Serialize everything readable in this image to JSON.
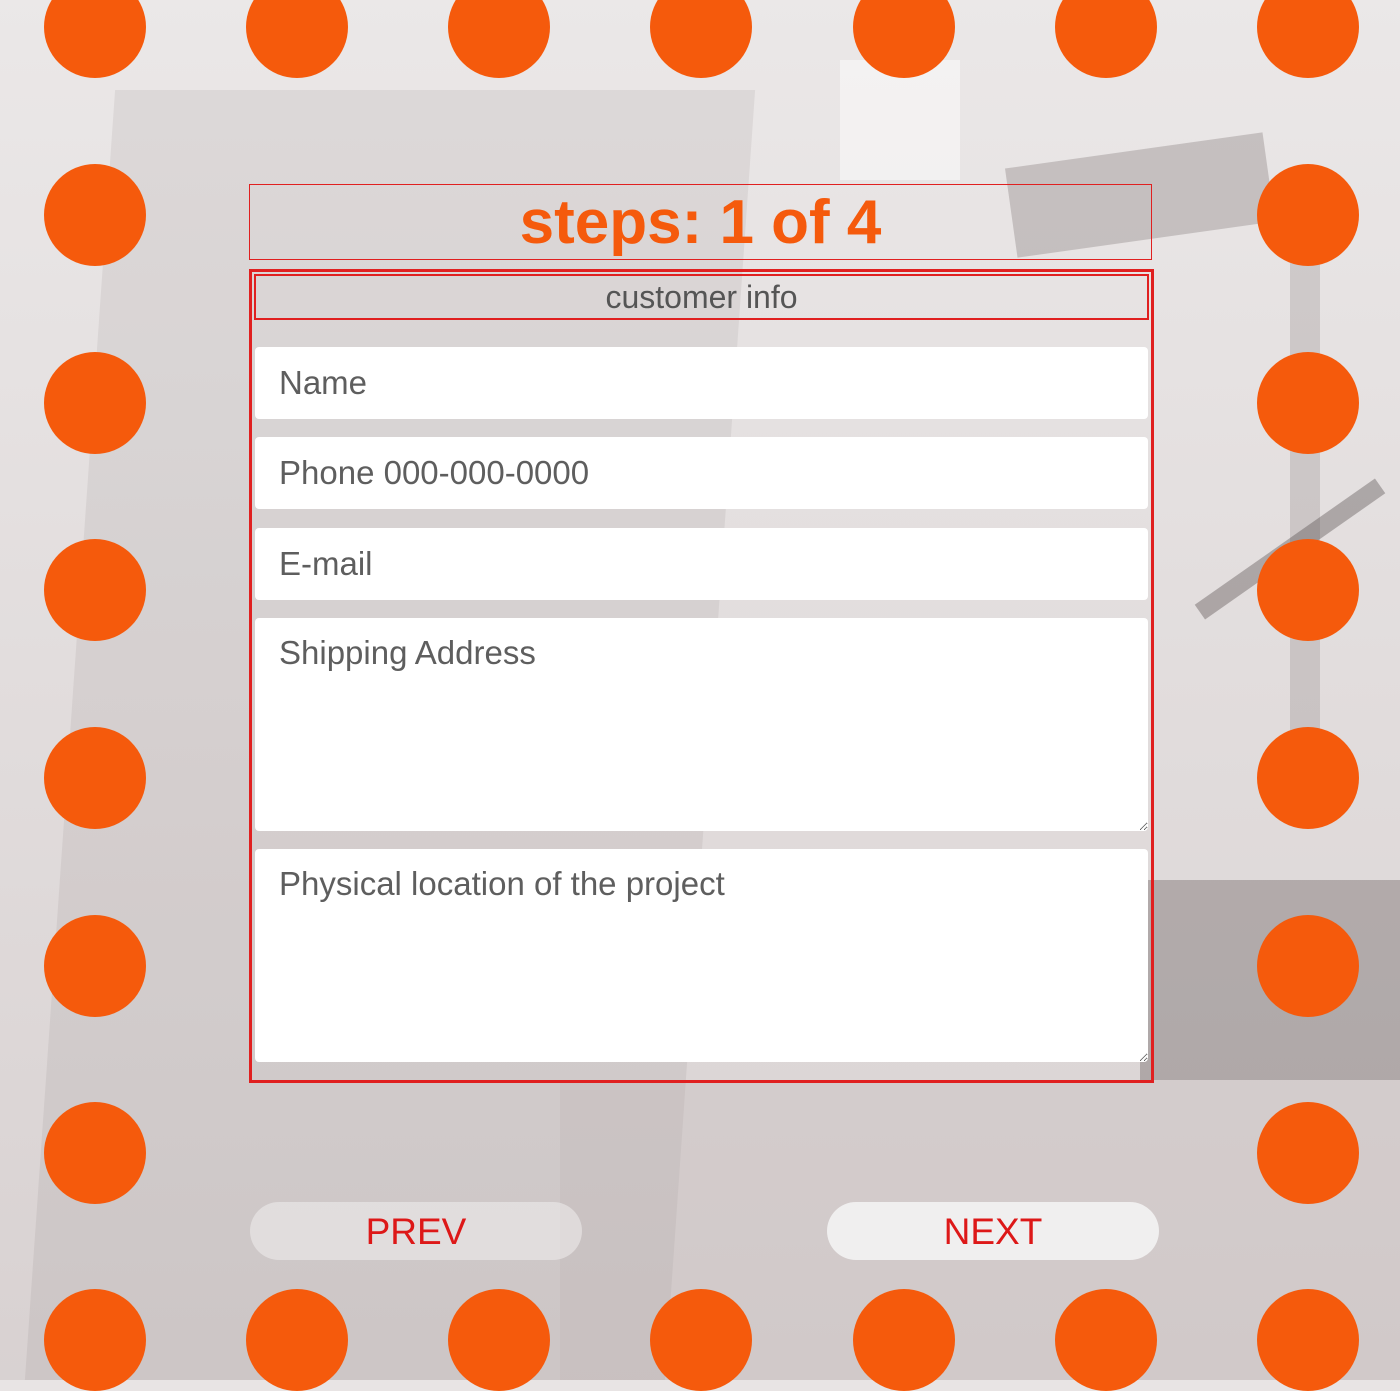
{
  "theme": {
    "dot_color": "#f55a0c",
    "accent_red": "#e02020",
    "button_text_color": "#dd1818"
  },
  "header": {
    "steps_label": "steps: 1 of 4"
  },
  "form": {
    "section_title": "customer info",
    "fields": {
      "name": {
        "placeholder": "Name"
      },
      "phone": {
        "placeholder": "Phone 000-000-0000"
      },
      "email": {
        "placeholder": "E-mail"
      },
      "shipping_address": {
        "placeholder": "Shipping Address"
      },
      "project_location": {
        "placeholder": "Physical location of the project"
      }
    }
  },
  "navigation": {
    "prev_label": "PREV",
    "next_label": "NEXT"
  }
}
